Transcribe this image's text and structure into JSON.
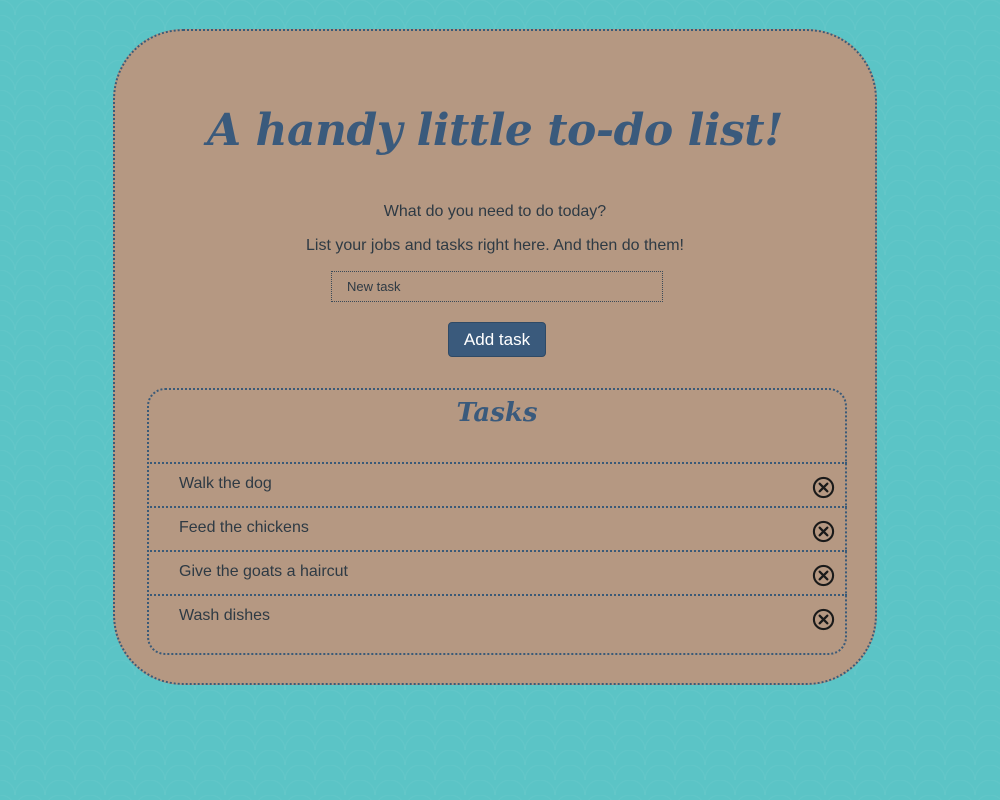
{
  "header": {
    "title": "A handy little to-do list!"
  },
  "intro": {
    "question": "What do you need to do today?",
    "instruction": "List your jobs and tasks right here. And then do them!"
  },
  "form": {
    "input_value": "",
    "input_placeholder": "New task",
    "add_label": "Add task"
  },
  "tasks": {
    "heading": "Tasks",
    "items": [
      {
        "label": "Walk the dog",
        "remove_icon": "remove-circle-x-icon"
      },
      {
        "label": "Feed the chickens",
        "remove_icon": "remove-circle-x-icon"
      },
      {
        "label": "Give the goats a haircut",
        "remove_icon": "remove-circle-x-icon"
      },
      {
        "label": "Wash dishes",
        "remove_icon": "remove-circle-x-icon"
      }
    ]
  },
  "colors": {
    "background": "#5bc4c6",
    "card": "#b59882",
    "accent": "#3a5a7c",
    "text": "#2e3a44"
  }
}
